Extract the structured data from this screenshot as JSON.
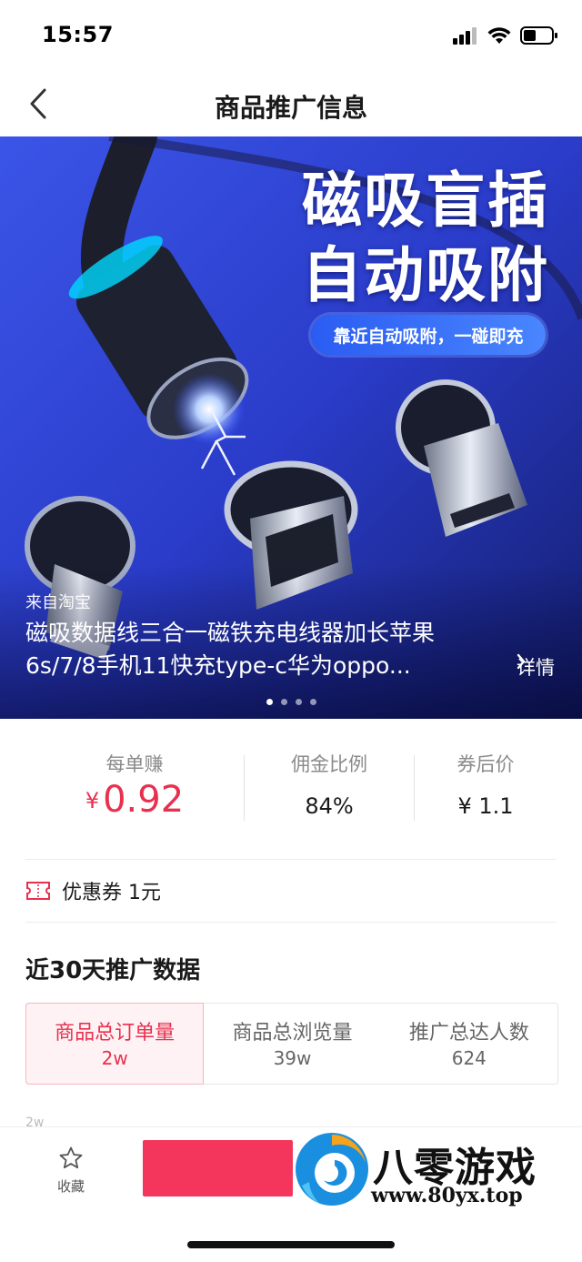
{
  "status_bar": {
    "time": "15:57"
  },
  "nav": {
    "title": "商品推广信息"
  },
  "banner": {
    "headline_line1": "磁吸盲插",
    "headline_line2": "自动吸附",
    "tag": "靠近自动吸附，一碰即充",
    "source": "来自淘宝",
    "title": "磁吸数据线三合一磁铁充电线器加长苹果6s/7/8手机11快充type-c华为oppo...",
    "detail": "详情",
    "page_count": 4,
    "active_page": 1
  },
  "stats": {
    "earn_label": "每单赚",
    "earn_currency": "¥",
    "earn_value": "0.92",
    "commission_label": "佣金比例",
    "commission_value": "84%",
    "price_label": "券后价",
    "price_value": "¥ 1.1"
  },
  "coupon": {
    "text": "优惠券 1元"
  },
  "section": {
    "title": "近30天推广数据",
    "tabs": [
      {
        "label": "商品总订单量",
        "value": "2w"
      },
      {
        "label": "商品总浏览量",
        "value": "39w"
      },
      {
        "label": "推广总达人数",
        "value": "624"
      }
    ],
    "active_tab": 0,
    "axis_peek": "2w"
  },
  "bottom": {
    "favorite_label": "收藏",
    "button_color": "#f5365c"
  },
  "watermark": {
    "name": "八零游戏",
    "url": "www.80yx.top"
  },
  "colors": {
    "accent": "#e8304f",
    "active_tab_bg": "#fff2f4"
  }
}
